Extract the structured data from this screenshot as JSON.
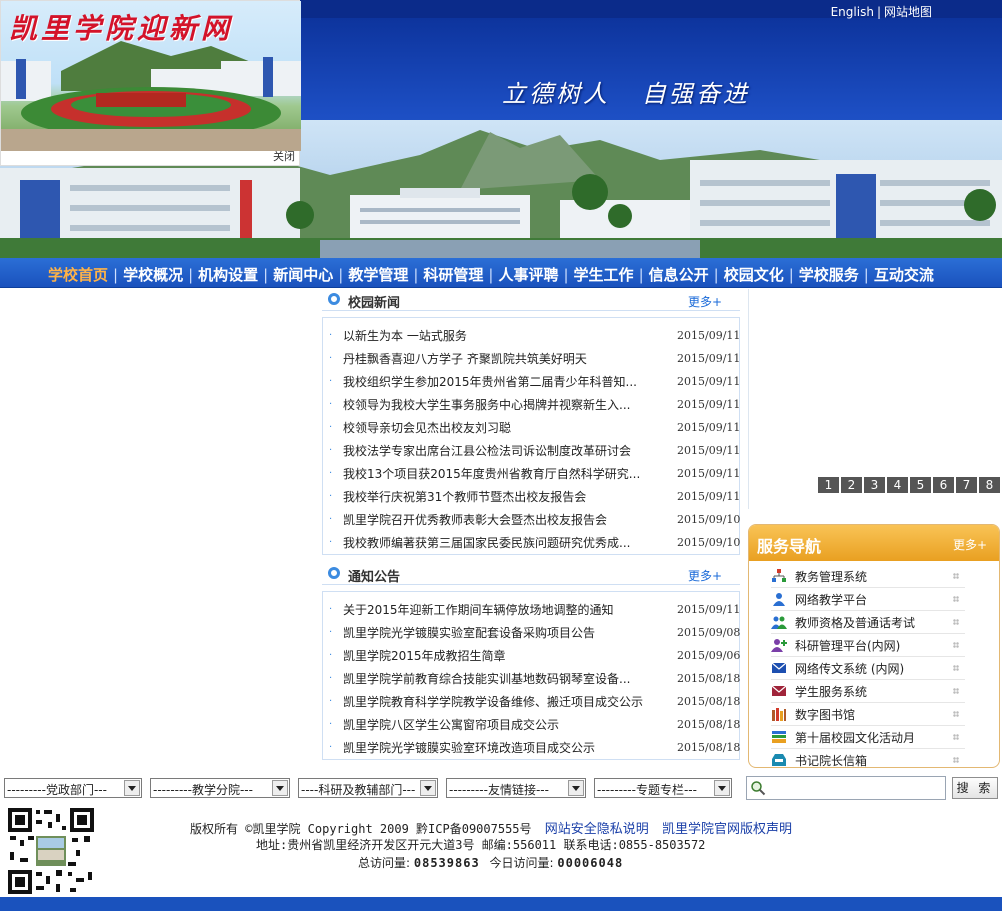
{
  "header": {
    "top_links": {
      "english": "English",
      "sitemap": "网站地图"
    },
    "motto": "立德树人   自强奋进"
  },
  "popup": {
    "title": "凯里学院迎新网",
    "close": "关闭"
  },
  "nav": {
    "items": [
      "学校首页",
      "学校概况",
      "机构设置",
      "新闻中心",
      "教学管理",
      "科研管理",
      "人事评聘",
      "学生工作",
      "信息公开",
      "校园文化",
      "学校服务",
      "互动交流"
    ],
    "active_index": 0,
    "accent_color": "#ffb347"
  },
  "news": {
    "title": "校园新闻",
    "more": "更多+",
    "items": [
      {
        "text": "以新生为本  一站式服务",
        "date": "2015/09/11"
      },
      {
        "text": "丹桂飘香喜迎八方学子  齐聚凯院共筑美好明天",
        "date": "2015/09/11"
      },
      {
        "text": "我校组织学生参加2015年贵州省第二届青少年科普知...",
        "date": "2015/09/11"
      },
      {
        "text": "校领导为我校大学生事务服务中心揭牌并视察新生入...",
        "date": "2015/09/11"
      },
      {
        "text": "校领导亲切会见杰出校友刘习聪",
        "date": "2015/09/11"
      },
      {
        "text": "我校法学专家出席台江县公检法司诉讼制度改革研讨会",
        "date": "2015/09/11"
      },
      {
        "text": "我校13个项目获2015年度贵州省教育厅自然科学研究...",
        "date": "2015/09/11"
      },
      {
        "text": "我校举行庆祝第31个教师节暨杰出校友报告会",
        "date": "2015/09/11"
      },
      {
        "text": "凯里学院召开优秀教师表彰大会暨杰出校友报告会",
        "date": "2015/09/10"
      },
      {
        "text": "我校教师编著获第三届国家民委民族问题研究优秀成...",
        "date": "2015/09/10"
      }
    ]
  },
  "notice": {
    "title": "通知公告",
    "more": "更多+",
    "items": [
      {
        "text": "关于2015年迎新工作期间车辆停放场地调整的通知",
        "date": "2015/09/11"
      },
      {
        "text": "凯里学院光学镀膜实验室配套设备采购项目公告",
        "date": "2015/09/08"
      },
      {
        "text": "凯里学院2015年成教招生简章",
        "date": "2015/09/06"
      },
      {
        "text": "凯里学院学前教育综合技能实训基地数码钢琴室设备...",
        "date": "2015/08/18"
      },
      {
        "text": "凯里学院教育科学学院教学设备维修、搬迁项目成交公示",
        "date": "2015/08/18"
      },
      {
        "text": "凯里学院八区学生公寓窗帘项目成交公示",
        "date": "2015/08/18"
      },
      {
        "text": "凯里学院光学镀膜实验室环境改造项目成交公示",
        "date": "2015/08/18"
      }
    ]
  },
  "slideshow": {
    "pages": [
      "1",
      "2",
      "3",
      "4",
      "5",
      "6",
      "7",
      "8"
    ]
  },
  "service": {
    "title": "服务导航",
    "more": "更多+",
    "items": [
      {
        "label": "教务管理系统",
        "icon": "org-chart-icon",
        "color": "#d23a2a"
      },
      {
        "label": "网络教学平台",
        "icon": "user-icon",
        "color": "#2a6fd2"
      },
      {
        "label": "教师资格及普通话考试",
        "icon": "users-icon",
        "color": "#2a6fd2"
      },
      {
        "label": "科研管理平台(内网)",
        "icon": "user-add-icon",
        "color": "#7a3fa8"
      },
      {
        "label": "网络传文系统 (内网)",
        "icon": "mail-icon",
        "color": "#1d4fb0"
      },
      {
        "label": "学生服务系统",
        "icon": "mail-icon",
        "color": "#a0243a"
      },
      {
        "label": "数字图书馆",
        "icon": "library-icon",
        "color": "#b05a2a"
      },
      {
        "label": "第十届校园文化活动月",
        "icon": "books-icon",
        "color": "#2a9a3a"
      },
      {
        "label": "书记院长信箱",
        "icon": "inbox-icon",
        "color": "#1a8ab0"
      }
    ]
  },
  "dropdowns": [
    "---------党政部门---",
    "---------教学分院---",
    "----科研及教辅部门---",
    "---------友情链接---",
    "---------专题专栏---"
  ],
  "search": {
    "button": "搜 索",
    "value": ""
  },
  "footer": {
    "copyright": "版权所有 ©凯里学院 Copyright 2009 黔ICP备09007555号",
    "privacy_link": "网站安全隐私说明",
    "rights_link": "凯里学院官网版权声明",
    "address": "地址:贵州省凯里经济开发区开元大道3号 邮编:556011 联系电话:0855-8503572",
    "total_label": "总访问量:",
    "total_value": "08539863",
    "today_label": "今日访问量:",
    "today_value": "00006048"
  }
}
